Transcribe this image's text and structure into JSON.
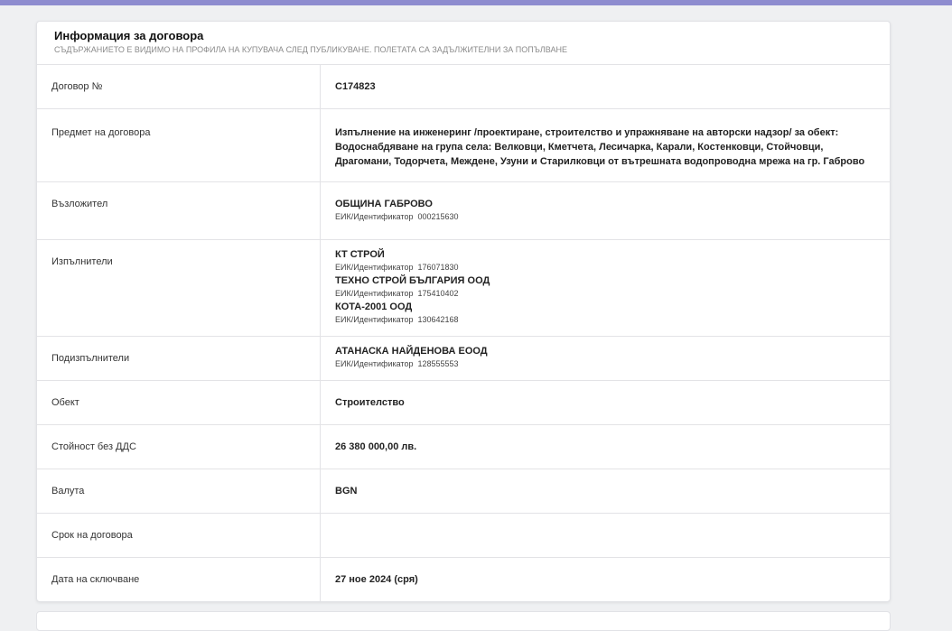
{
  "header": {
    "title": "Информация за договора",
    "subtitle": "СЪДЪРЖАНИЕТО Е ВИДИМО НА ПРОФИЛА НА КУПУВАЧА СЛЕД ПУБЛИКУВАНЕ. ПОЛЕТАТА СА ЗАДЪЛЖИТЕЛНИ ЗА ПОПЪЛВАНЕ"
  },
  "contract_number": {
    "label": "Договор №",
    "value": "C174823"
  },
  "subject": {
    "label": "Предмет на договора",
    "value": "Изпълнение на инженеринг /проектиране, строителство и упражняване на авторски надзор/ за обект: Водоснабдяване на група села: Велковци, Кметчета, Лесичарка, Карали, Костенковци, Стойчовци, Драгомани, Тодорчета, Междене, Узуни и Старилковци от вътрешната водопроводна мрежа на гр. Габрово"
  },
  "contracting_authority": {
    "label": "Възложител",
    "name": "ОБЩИНА ГАБРОВО",
    "eik_label": "ЕИК/Идентификатор",
    "eik": "000215630"
  },
  "contractors": {
    "label": "Изпълнители",
    "eik_label": "ЕИК/Идентификатор",
    "items": [
      {
        "name": "КТ СТРОЙ",
        "eik": "176071830"
      },
      {
        "name": "ТЕХНО СТРОЙ БЪЛГАРИЯ ООД",
        "eik": "175410402"
      },
      {
        "name": "КОТА-2001 ООД",
        "eik": "130642168"
      }
    ]
  },
  "subcontractors": {
    "label": "Подизпълнители",
    "eik_label": "ЕИК/Идентификатор",
    "items": [
      {
        "name": "АТАНАСКА НАЙДЕНОВА ЕООД",
        "eik": "128555553"
      }
    ]
  },
  "object": {
    "label": "Обект",
    "value": "Строителство"
  },
  "value_excl_vat": {
    "label": "Стойност без ДДС",
    "value": "26 380 000,00 лв."
  },
  "currency": {
    "label": "Валута",
    "value": "BGN"
  },
  "term": {
    "label": "Срок на договора",
    "value": ""
  },
  "conclusion_date": {
    "label": "Дата на сключване",
    "value": "27 ное 2024 (сря)"
  }
}
